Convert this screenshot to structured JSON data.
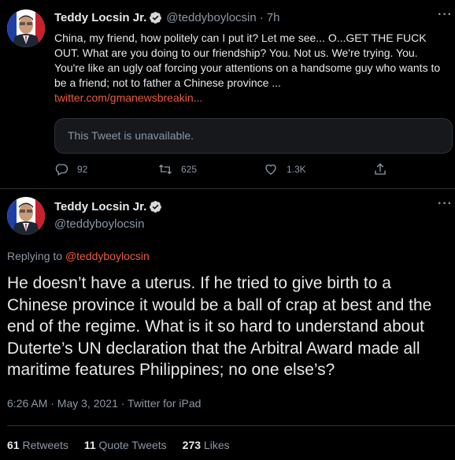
{
  "tweet1": {
    "name": "Teddy Locsin Jr.",
    "handle": "@teddyboylocsin",
    "time": "7h",
    "text": "China, my friend, how politely can I put it? Let me see... O...GET THE FUCK OUT. What are you doing to our friendship? You. Not us. We're trying. You. You're like an ugly oaf forcing your attentions on a handsome guy who wants to be a friend; not to father a Chinese province ...",
    "link": "twitter.com/gmanewsbreakin...",
    "quoted_unavailable": "This Tweet is unavailable.",
    "replies": "92",
    "retweets": "625",
    "likes": "1.3K",
    "more": "···"
  },
  "tweet2": {
    "name": "Teddy Locsin Jr.",
    "handle": "@teddyboylocsin",
    "replying_prefix": "Replying to",
    "replying_to": "@teddyboylocsin",
    "text": "He doesn’t have a uterus. If he tried to give birth to a Chinese province it would be a ball of crap at best and the end of the regime. What is it so hard to understand about Duterte’s UN declaration that the Arbitral Award made all maritime features Philippines; no one else’s?",
    "meta": "6:26 AM · May 3, 2021 · Twitter for iPad",
    "retweets_count": "61",
    "retweets_label": "Retweets",
    "quotes_count": "11",
    "quotes_label": "Quote Tweets",
    "likes_count": "273",
    "likes_label": "Likes",
    "more": "···"
  },
  "colors": {
    "background": "#000000",
    "link": "#ea5a3f",
    "muted": "#8b98a5",
    "verified": "#d9d9d9"
  },
  "icons": [
    "reply-icon",
    "retweet-icon",
    "like-icon",
    "share-icon",
    "verified-badge-icon",
    "more-icon"
  ]
}
